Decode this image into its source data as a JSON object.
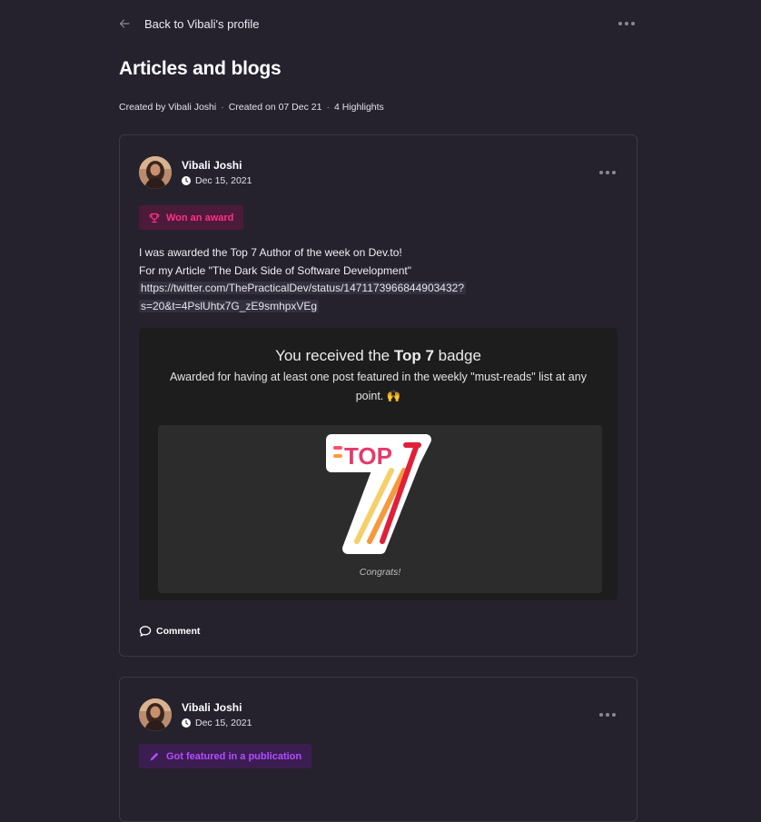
{
  "nav": {
    "back_label": "Back to Vibali's profile"
  },
  "page": {
    "title": "Articles and blogs",
    "created_by": "Created by Vibali Joshi",
    "created_on": "Created on 07 Dec 21",
    "highlights": "4 Highlights",
    "separator": "·"
  },
  "posts": [
    {
      "author": "Vibali Joshi",
      "date": "Dec 15, 2021",
      "badge": "Won an award",
      "text_line1": "I was awarded the Top 7 Author of the week on Dev.to!",
      "text_line2": "For my Article \"The Dark Side of Software Development\"",
      "link_line1": "https://twitter.com/ThePracticalDev/status/1471173966844903432?",
      "link_line2": "s=20&t=4PslUhtx7G_zE9smhpxVEg",
      "embed": {
        "title_prefix": "You received the ",
        "title_bold": "Top 7",
        "title_suffix": " badge",
        "subtitle": "Awarded for having at least one post featured in the weekly \"must-reads\" list at any point. 🙌",
        "badge_text": "TOP",
        "caption": "Congrats!"
      },
      "comment_label": "Comment"
    },
    {
      "author": "Vibali Joshi",
      "date": "Dec 15, 2021",
      "badge": "Got featured in a publication"
    }
  ],
  "colors": {
    "background": "#25222e",
    "award_badge": "#ff2f8a",
    "publication_badge": "#b34dff"
  }
}
